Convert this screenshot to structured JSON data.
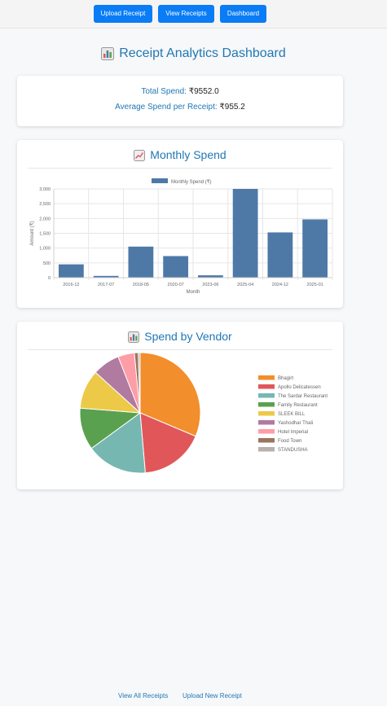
{
  "nav": {
    "upload": "Upload Receipt",
    "view": "View Receipts",
    "dashboard": "Dashboard"
  },
  "page": {
    "title": "Receipt Analytics Dashboard"
  },
  "summary": {
    "total_label": "Total Spend:",
    "total_value": "₹9552.0",
    "avg_label": "Average Spend per Receipt:",
    "avg_value": "₹955.2"
  },
  "monthly": {
    "title": "Monthly Spend",
    "icon": "line-chart-icon"
  },
  "vendor": {
    "title": "Spend by Vendor",
    "icon": "bar-chart-icon"
  },
  "footer": {
    "view_all": "View All Receipts",
    "upload_new": "Upload New Receipt"
  },
  "colors": {
    "accent": "#1f78b4",
    "button": "#0a7cf5",
    "bar": "#4e79a7"
  },
  "chart_data": [
    {
      "type": "bar",
      "title": "",
      "legend": [
        "Monthly Spend (₹)"
      ],
      "legend_position": "top",
      "xlabel": "Month",
      "ylabel": "Amount (₹)",
      "categories": [
        "2016-12",
        "2017-07",
        "2018-05",
        "2020-07",
        "2023-06",
        "2025-04",
        "2024-12",
        "2025-01"
      ],
      "series": [
        {
          "name": "Monthly Spend (₹)",
          "values": [
            450,
            60,
            1050,
            730,
            80,
            3000,
            1530,
            1970
          ]
        }
      ],
      "ylim": [
        0,
        3000
      ],
      "yticks": [
        "0",
        "500",
        "1,000",
        "1,500",
        "2,000",
        "2,500",
        "3,000"
      ],
      "grid": true
    },
    {
      "type": "pie",
      "legend_position": "right",
      "labels": [
        "Bhagirt",
        "Apollo Delicatessen",
        "The Sardar Restaurant",
        "Family Restaurant",
        "SLEEK BILL",
        "Yashodhar Thali",
        "Hotel Imperial",
        "Food Town",
        "STANDUSHA"
      ],
      "values": [
        2995,
        1650,
        1560,
        1080,
        1000,
        700,
        420,
        100,
        47
      ],
      "colors": [
        "#f28e2b",
        "#e15759",
        "#76b7b2",
        "#59a14f",
        "#edc948",
        "#b07aa1",
        "#ff9da7",
        "#9c755f",
        "#bab0ac"
      ]
    }
  ]
}
